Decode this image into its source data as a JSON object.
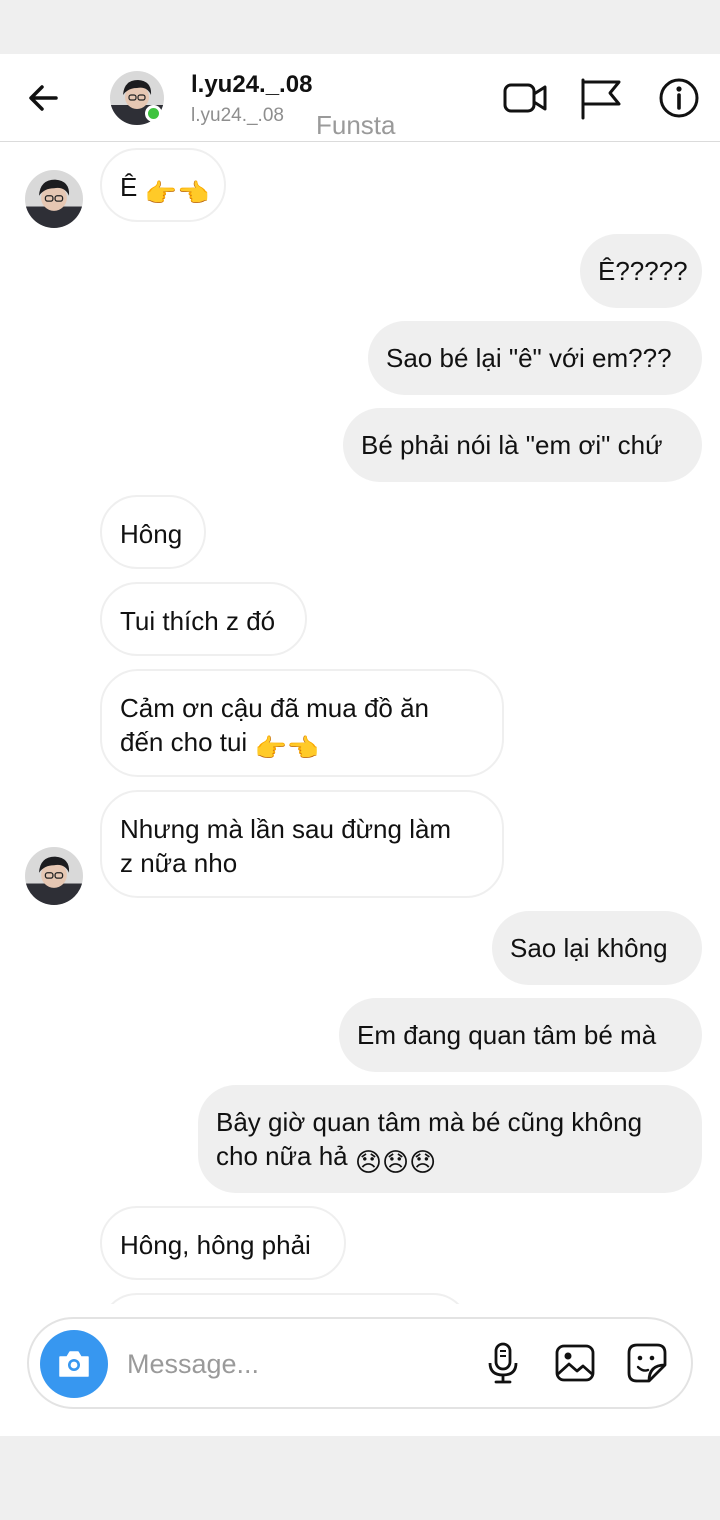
{
  "header": {
    "name": "l.yu24._.08",
    "username": "l.yu24._.08",
    "tag": "Funsta"
  },
  "icons": {
    "back": "arrow-left-icon",
    "video": "video-camera-icon",
    "report": "flag-icon",
    "info": "info-icon",
    "camera": "camera-icon",
    "mic": "microphone-icon",
    "gallery": "image-icon",
    "sticker": "sticker-icon"
  },
  "emoji": {
    "point_right": "👉",
    "point_left": "👈",
    "disappointed": "😞"
  },
  "messages": [
    {
      "side": "in",
      "text": "Ê",
      "emoji": "point_right,point_left"
    },
    {
      "side": "out",
      "text": "Ê?????"
    },
    {
      "side": "out",
      "text": "Sao bé lại \"ê\" với em???"
    },
    {
      "side": "out",
      "text": "Bé phải nói là \"em ơi\" chứ"
    },
    {
      "side": "in",
      "text": "Hông"
    },
    {
      "side": "in",
      "text": "Tui thích z đó"
    },
    {
      "side": "in",
      "line1": "Cảm ơn cậu đã mua đồ ăn",
      "line2": "đến cho tui",
      "emoji": "point_right,point_left"
    },
    {
      "side": "in",
      "line1": "Nhưng mà lần sau đừng làm",
      "line2": "z nữa nho"
    },
    {
      "side": "out",
      "text": "Sao lại không"
    },
    {
      "side": "out",
      "text": "Em đang quan tâm bé mà"
    },
    {
      "side": "out",
      "line1": "Bây giờ quan tâm mà bé cũng không",
      "line2": "cho nữa hả",
      "emoji": "disappointed,disappointed,disappointed"
    },
    {
      "side": "in",
      "text": "Hông, hông phải"
    }
  ],
  "composer": {
    "placeholder": "Message..."
  },
  "colors": {
    "accent": "#3797f0",
    "online": "#3ec33e",
    "outgoing_bubble": "#efefef"
  }
}
